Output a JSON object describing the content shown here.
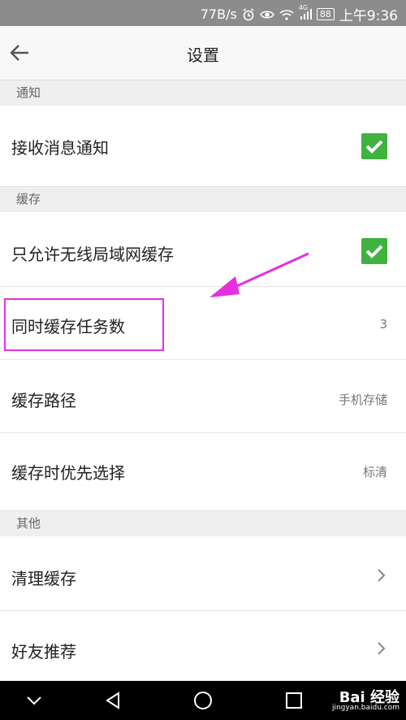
{
  "status_bar": {
    "speed": "77B/s",
    "signal_type": "4G",
    "battery": "88",
    "time": "上午9:36"
  },
  "header": {
    "title": "设置"
  },
  "sections": {
    "notify": {
      "title": "通知",
      "receive_label": "接收消息通知",
      "receive_checked": true
    },
    "cache": {
      "title": "缓存",
      "wifi_only_label": "只允许无线局域网缓存",
      "wifi_only_checked": true,
      "concurrent_label": "同时缓存任务数",
      "concurrent_value": "3",
      "path_label": "缓存路径",
      "path_value": "手机存储",
      "priority_label": "缓存时优先选择",
      "priority_value": "标清"
    },
    "other": {
      "title": "其他",
      "clear_label": "清理缓存",
      "recommend_label": "好友推荐"
    }
  },
  "watermark": {
    "brand": "Bai 经验",
    "url": "jingyan.baidu.com"
  },
  "colors": {
    "check_green": "#3fb23f",
    "highlight_magenta": "#e62fe0",
    "status_bar": "#8c8c8c"
  }
}
